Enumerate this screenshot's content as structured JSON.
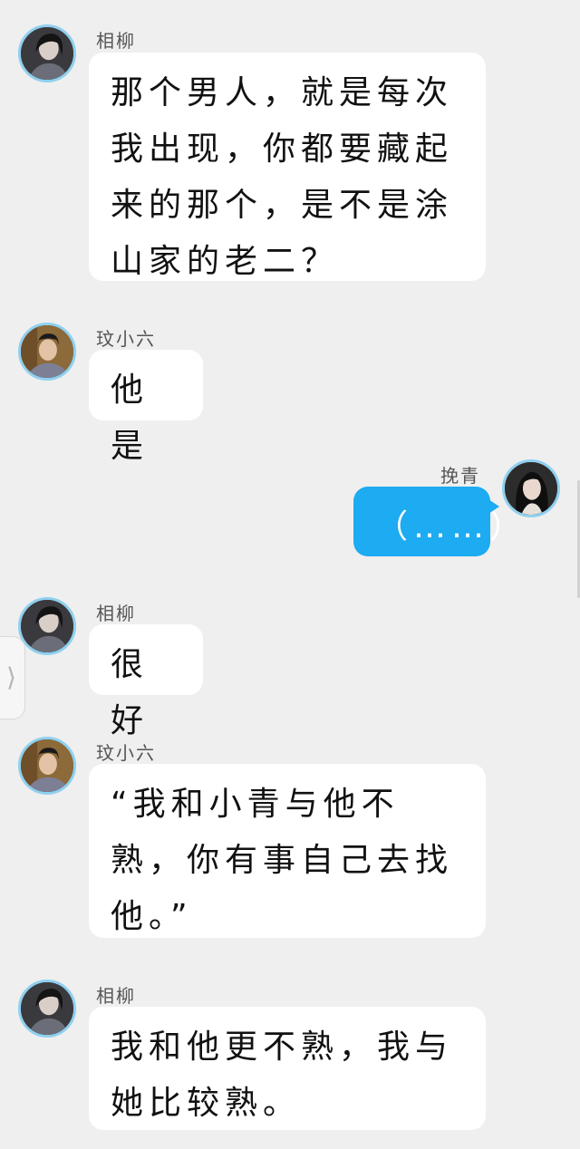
{
  "conversation": {
    "messages": [
      {
        "sender": "相柳",
        "text": "那个男人，就是每次我出现，你都要藏起来的那个，是不是涂山家的老二？",
        "side": "left",
        "avatar": "dark-haired-person-avatar"
      },
      {
        "sender": "玟小六",
        "text": "他是",
        "side": "left",
        "avatar": "person-in-hat-avatar"
      },
      {
        "sender": "挽青",
        "text": "（……）",
        "side": "right",
        "avatar": "long-haired-person-avatar"
      },
      {
        "sender": "相柳",
        "text": "很好",
        "side": "left",
        "avatar": "dark-haired-person-avatar"
      },
      {
        "sender": "玟小六",
        "text": "“我和小青与他不熟，你有事自己去找他。”",
        "side": "left",
        "avatar": "person-in-hat-avatar"
      },
      {
        "sender": "相柳",
        "text": "我和他更不熟，我与她比较熟。",
        "side": "left",
        "avatar": "dark-haired-person-avatar"
      }
    ]
  },
  "side_panel": {
    "toggle_glyph": "⟩",
    "icon": "chevron-right-icon"
  },
  "colors": {
    "background": "#efefef",
    "bubble_left": "#ffffff",
    "bubble_right": "#1dabf1",
    "avatar_ring": "#8fd0ef"
  }
}
